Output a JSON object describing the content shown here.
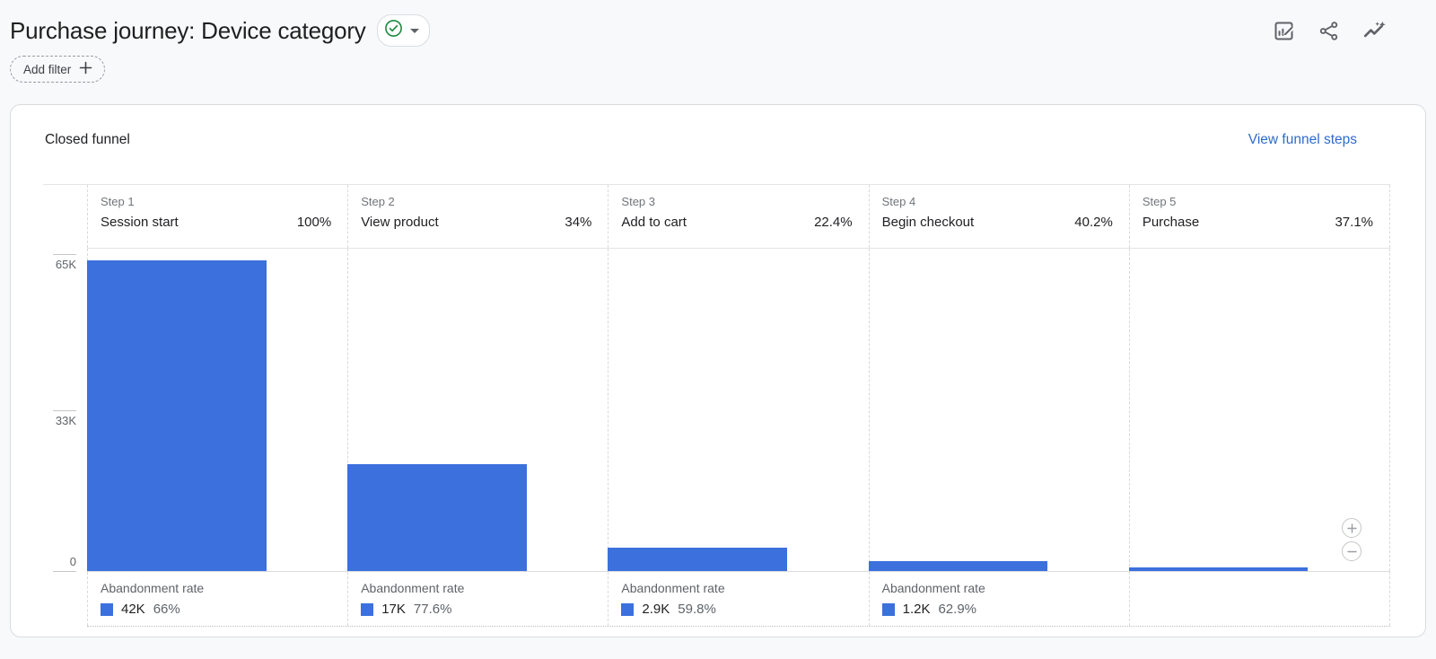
{
  "header": {
    "title": "Purchase journey: Device category",
    "status_badge": {
      "icon": "check-circle-icon",
      "color": "#1b8a3f"
    },
    "add_filter_label": "Add filter",
    "actions": [
      {
        "icon": "edit-chart-icon"
      },
      {
        "icon": "share-icon"
      },
      {
        "icon": "insights-icon"
      }
    ]
  },
  "panel": {
    "heading": "Closed funnel",
    "link_label": "View funnel steps"
  },
  "chart_data": {
    "type": "bar",
    "variant": "closed-funnel",
    "title": "Closed funnel",
    "y_axis": {
      "ticks": [
        "65K",
        "33K",
        "0"
      ],
      "max_value": 65000,
      "ylim": [
        0,
        66500
      ]
    },
    "steps": [
      {
        "step": "Step 1",
        "name": "Session start",
        "completion_rate": "100%",
        "count": 63600,
        "abandonment": {
          "label": "Abandonment rate",
          "count": "42K",
          "rate": "66%"
        }
      },
      {
        "step": "Step 2",
        "name": "View product",
        "completion_rate": "34%",
        "count": 21900,
        "abandonment": {
          "label": "Abandonment rate",
          "count": "17K",
          "rate": "77.6%"
        }
      },
      {
        "step": "Step 3",
        "name": "Add to cart",
        "completion_rate": "22.4%",
        "count": 4850,
        "abandonment": {
          "label": "Abandonment rate",
          "count": "2.9K",
          "rate": "59.8%"
        }
      },
      {
        "step": "Step 4",
        "name": "Begin checkout",
        "completion_rate": "40.2%",
        "count": 1950,
        "abandonment": {
          "label": "Abandonment rate",
          "count": "1.2K",
          "rate": "62.9%"
        }
      },
      {
        "step": "Step 5",
        "name": "Purchase",
        "completion_rate": "37.1%",
        "count": 730,
        "abandonment": null
      }
    ],
    "legend_position": "none",
    "grid": "minimal"
  },
  "colors": {
    "bar": "#3b70dd",
    "link": "#2e6bcd",
    "check_green": "#1b8a3f"
  }
}
